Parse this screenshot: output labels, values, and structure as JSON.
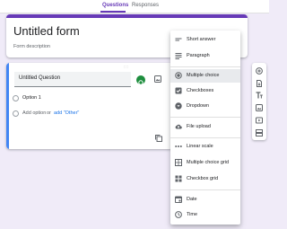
{
  "tabs": [
    {
      "label": "Questions",
      "active": true
    },
    {
      "label": "Responses",
      "active": false
    }
  ],
  "form": {
    "title": "Untitled form",
    "description_placeholder": "Form description"
  },
  "question": {
    "title": "Untitled Question",
    "options": [
      "Option 1"
    ],
    "add_option_label": "Add option",
    "or_label": "or",
    "add_other_label": "add \"Other\""
  },
  "type_menu": {
    "items": [
      {
        "label": "Short answer",
        "icon": "short-answer-icon"
      },
      {
        "label": "Paragraph",
        "icon": "paragraph-icon"
      },
      {
        "label": "Multiple choice",
        "icon": "radio-button-icon",
        "selected": true
      },
      {
        "label": "Checkboxes",
        "icon": "checkbox-icon"
      },
      {
        "label": "Dropdown",
        "icon": "dropdown-icon"
      },
      {
        "label": "File upload",
        "icon": "cloud-upload-icon"
      },
      {
        "label": "Linear scale",
        "icon": "linear-scale-icon"
      },
      {
        "label": "Multiple choice grid",
        "icon": "grid-icon"
      },
      {
        "label": "Checkbox grid",
        "icon": "checkbox-grid-icon"
      },
      {
        "label": "Date",
        "icon": "calendar-icon"
      },
      {
        "label": "Time",
        "icon": "clock-icon"
      }
    ]
  },
  "toolbar": {
    "icons": [
      "add-question-icon",
      "import-questions-icon",
      "add-title-icon",
      "add-image-icon",
      "add-video-icon",
      "add-section-icon"
    ]
  },
  "colors": {
    "accent": "#673ab7",
    "background": "#f0ebf8",
    "active_question_border": "#4285f4"
  }
}
